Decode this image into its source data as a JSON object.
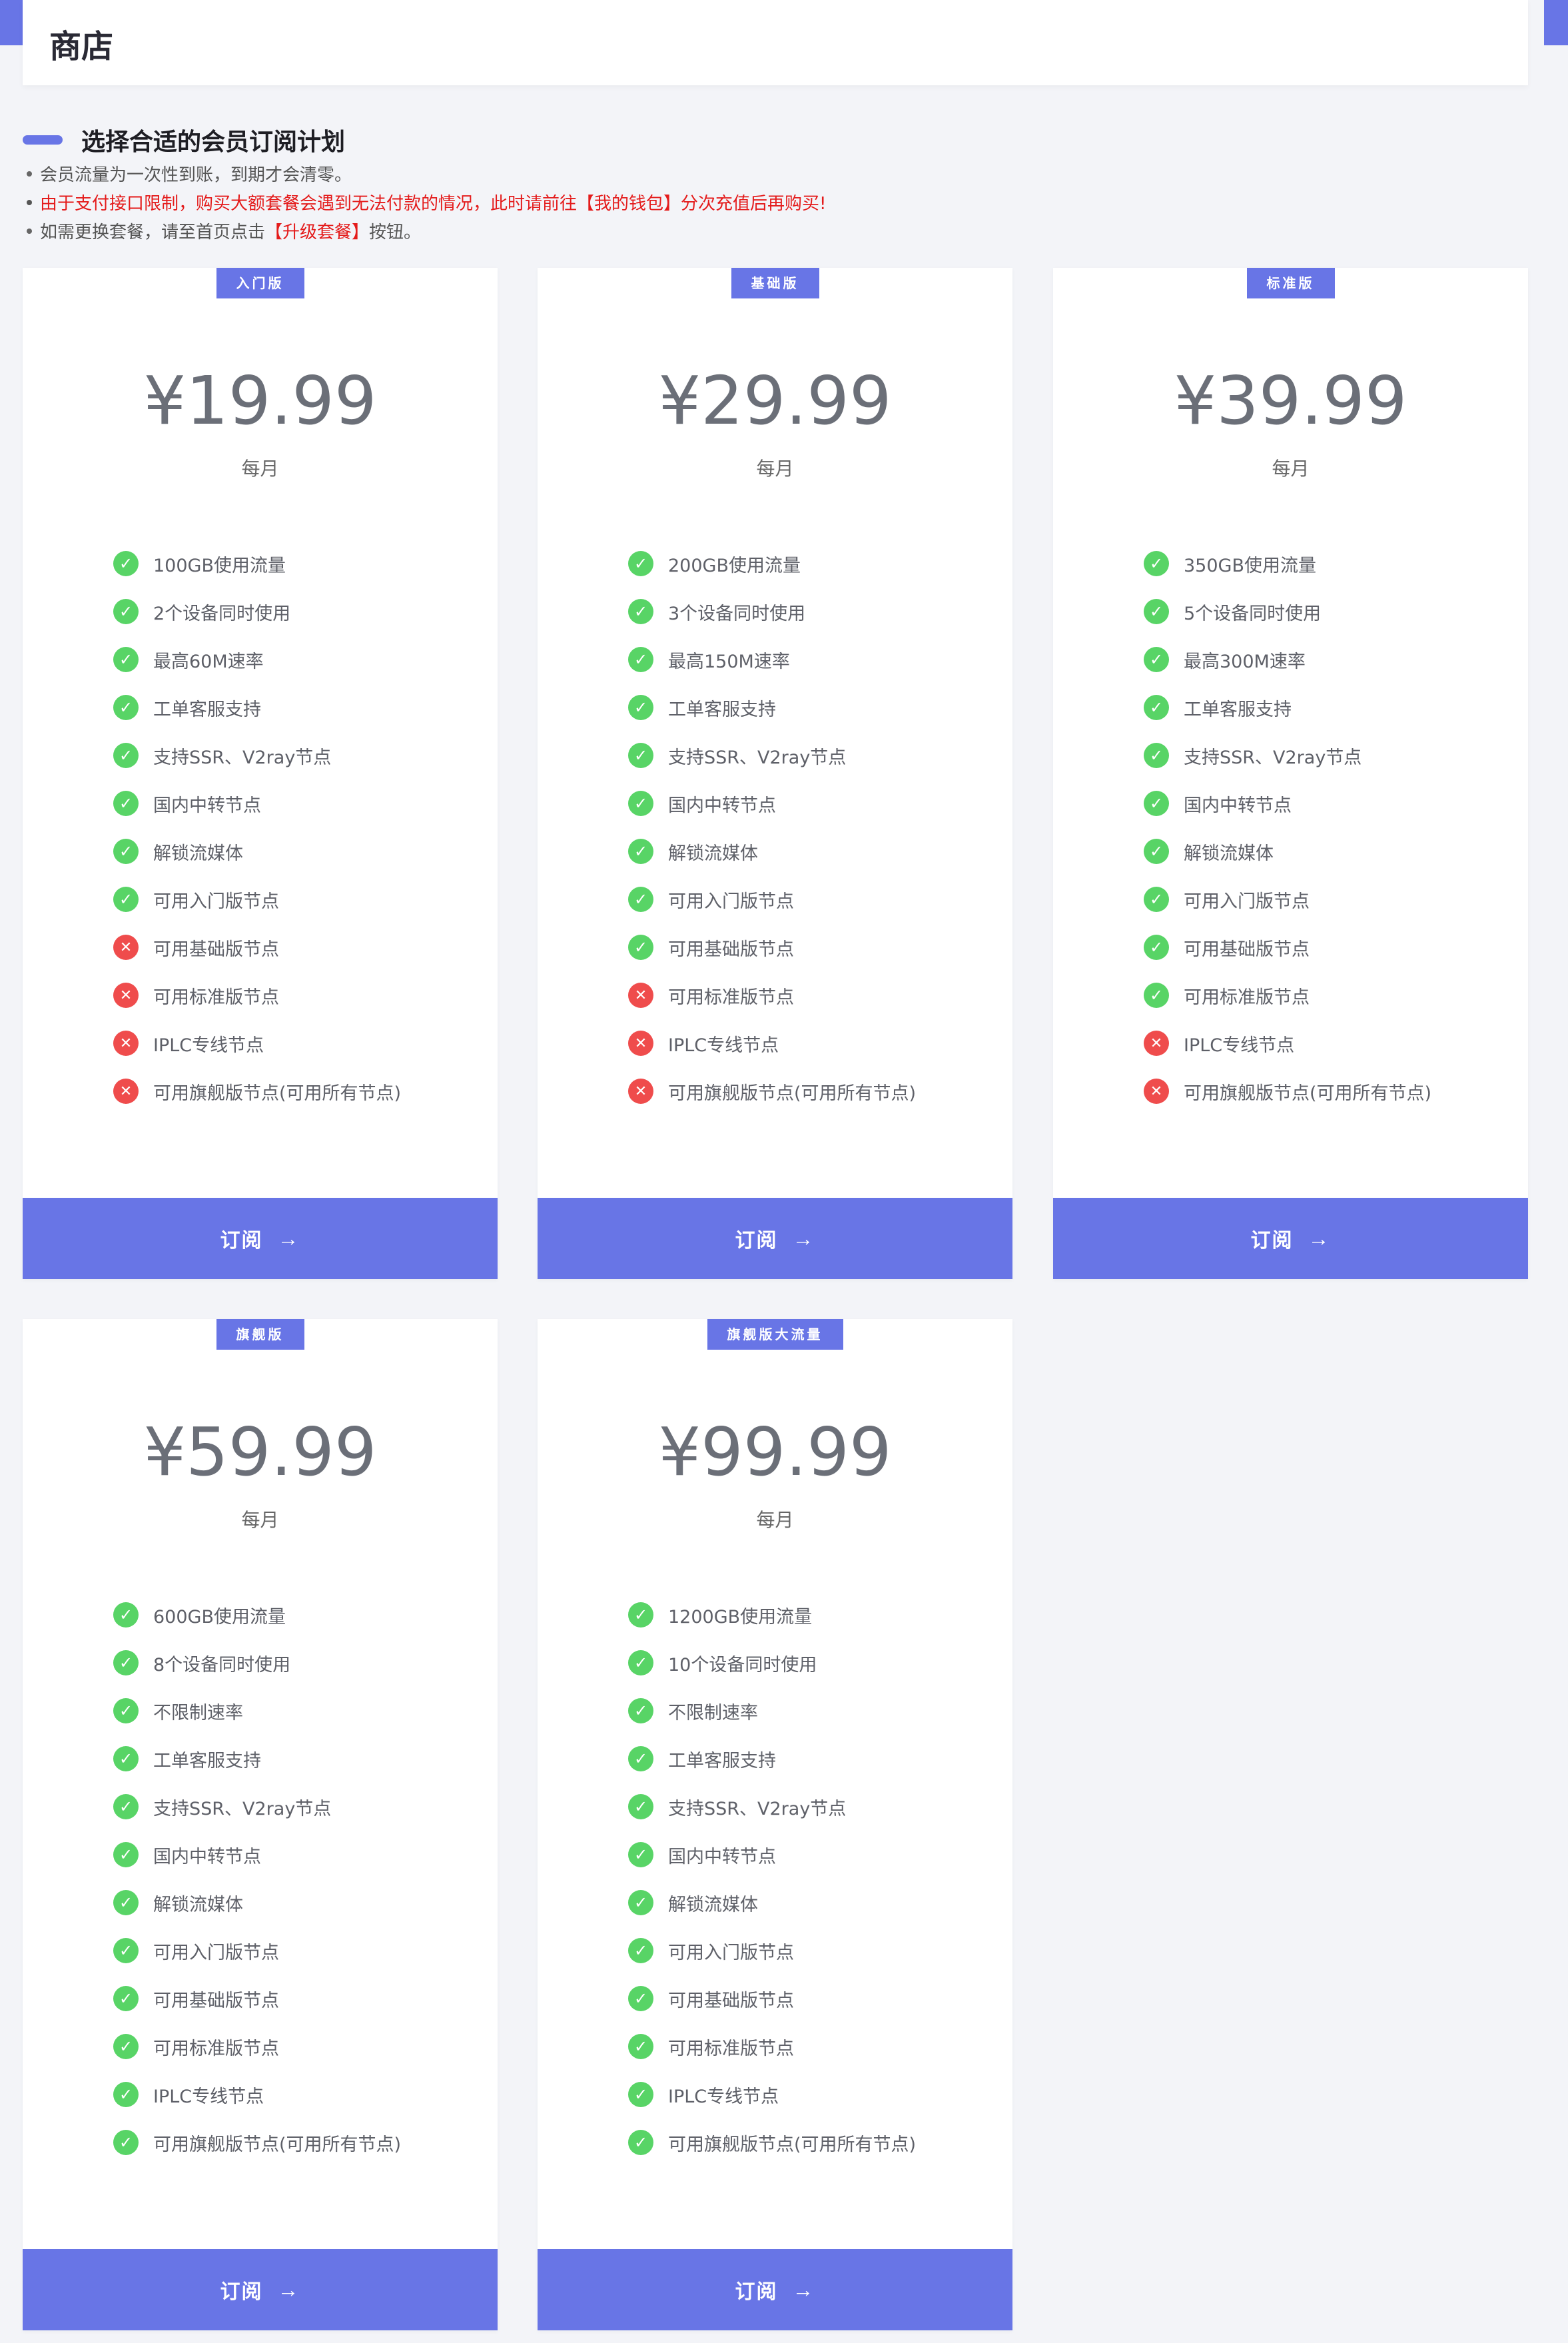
{
  "page": {
    "title": "商店"
  },
  "section": {
    "title": "选择合适的会员订阅计划",
    "notes": [
      "会员流量为一次性到账，到期才会清零。",
      "由于支付接口限制，购买大额套餐会遇到无法付款的情况，此时请前往【我的钱包】分次充值后再购买!",
      {
        "before": "如需更换套餐，请至首页点击",
        "highlight": "【升级套餐】",
        "after": "按钮。"
      }
    ]
  },
  "colors": {
    "accent": "#6875e6",
    "ok": "#58d466",
    "no": "#ef4c4c",
    "warning_text": "#e41b1b"
  },
  "plans": [
    {
      "badge": "入门版",
      "price": "¥19.99",
      "period": "每月",
      "subscribe_label": "订阅",
      "features": [
        {
          "text": "100GB使用流量",
          "ok": true
        },
        {
          "text": "2个设备同时使用",
          "ok": true
        },
        {
          "text": "最高60M速率",
          "ok": true
        },
        {
          "text": "工单客服支持",
          "ok": true
        },
        {
          "text": "支持SSR、V2ray节点",
          "ok": true
        },
        {
          "text": "国内中转节点",
          "ok": true
        },
        {
          "text": "解锁流媒体",
          "ok": true
        },
        {
          "text": "可用入门版节点",
          "ok": true
        },
        {
          "text": "可用基础版节点",
          "ok": false
        },
        {
          "text": "可用标准版节点",
          "ok": false
        },
        {
          "text": "IPLC专线节点",
          "ok": false
        },
        {
          "text": "可用旗舰版节点(可用所有节点)",
          "ok": false
        }
      ]
    },
    {
      "badge": "基础版",
      "price": "¥29.99",
      "period": "每月",
      "subscribe_label": "订阅",
      "features": [
        {
          "text": "200GB使用流量",
          "ok": true
        },
        {
          "text": "3个设备同时使用",
          "ok": true
        },
        {
          "text": "最高150M速率",
          "ok": true
        },
        {
          "text": "工单客服支持",
          "ok": true
        },
        {
          "text": "支持SSR、V2ray节点",
          "ok": true
        },
        {
          "text": "国内中转节点",
          "ok": true
        },
        {
          "text": "解锁流媒体",
          "ok": true
        },
        {
          "text": "可用入门版节点",
          "ok": true
        },
        {
          "text": "可用基础版节点",
          "ok": true
        },
        {
          "text": "可用标准版节点",
          "ok": false
        },
        {
          "text": "IPLC专线节点",
          "ok": false
        },
        {
          "text": "可用旗舰版节点(可用所有节点)",
          "ok": false
        }
      ]
    },
    {
      "badge": "标准版",
      "price": "¥39.99",
      "period": "每月",
      "subscribe_label": "订阅",
      "features": [
        {
          "text": "350GB使用流量",
          "ok": true
        },
        {
          "text": "5个设备同时使用",
          "ok": true
        },
        {
          "text": "最高300M速率",
          "ok": true
        },
        {
          "text": "工单客服支持",
          "ok": true
        },
        {
          "text": "支持SSR、V2ray节点",
          "ok": true
        },
        {
          "text": "国内中转节点",
          "ok": true
        },
        {
          "text": "解锁流媒体",
          "ok": true
        },
        {
          "text": "可用入门版节点",
          "ok": true
        },
        {
          "text": "可用基础版节点",
          "ok": true
        },
        {
          "text": "可用标准版节点",
          "ok": true
        },
        {
          "text": "IPLC专线节点",
          "ok": false
        },
        {
          "text": "可用旗舰版节点(可用所有节点)",
          "ok": false
        }
      ]
    },
    {
      "badge": "旗舰版",
      "price": "¥59.99",
      "period": "每月",
      "subscribe_label": "订阅",
      "features": [
        {
          "text": "600GB使用流量",
          "ok": true
        },
        {
          "text": "8个设备同时使用",
          "ok": true
        },
        {
          "text": "不限制速率",
          "ok": true
        },
        {
          "text": "工单客服支持",
          "ok": true
        },
        {
          "text": "支持SSR、V2ray节点",
          "ok": true
        },
        {
          "text": "国内中转节点",
          "ok": true
        },
        {
          "text": "解锁流媒体",
          "ok": true
        },
        {
          "text": "可用入门版节点",
          "ok": true
        },
        {
          "text": "可用基础版节点",
          "ok": true
        },
        {
          "text": "可用标准版节点",
          "ok": true
        },
        {
          "text": "IPLC专线节点",
          "ok": true
        },
        {
          "text": "可用旗舰版节点(可用所有节点)",
          "ok": true
        }
      ]
    },
    {
      "badge": "旗舰版大流量",
      "price": "¥99.99",
      "period": "每月",
      "subscribe_label": "订阅",
      "features": [
        {
          "text": "1200GB使用流量",
          "ok": true
        },
        {
          "text": "10个设备同时使用",
          "ok": true
        },
        {
          "text": "不限制速率",
          "ok": true
        },
        {
          "text": "工单客服支持",
          "ok": true
        },
        {
          "text": "支持SSR、V2ray节点",
          "ok": true
        },
        {
          "text": "国内中转节点",
          "ok": true
        },
        {
          "text": "解锁流媒体",
          "ok": true
        },
        {
          "text": "可用入门版节点",
          "ok": true
        },
        {
          "text": "可用基础版节点",
          "ok": true
        },
        {
          "text": "可用标准版节点",
          "ok": true
        },
        {
          "text": "IPLC专线节点",
          "ok": true
        },
        {
          "text": "可用旗舰版节点(可用所有节点)",
          "ok": true
        }
      ]
    }
  ]
}
